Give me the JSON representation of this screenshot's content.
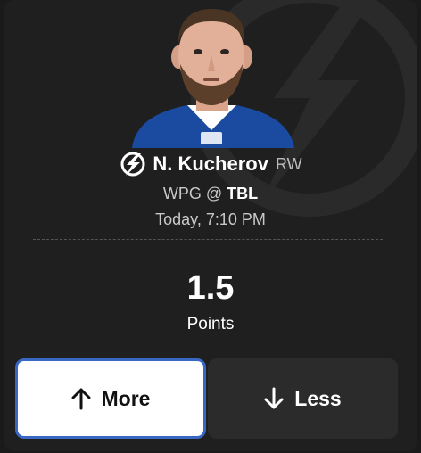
{
  "player": {
    "name": "N. Kucherov",
    "position": "RW"
  },
  "game": {
    "away_team": "WPG",
    "separator": "@",
    "home_team": "TBL",
    "time": "Today, 7:10 PM"
  },
  "projection": {
    "line": "1.5",
    "stat": "Points"
  },
  "actions": {
    "more_label": "More",
    "less_label": "Less"
  },
  "colors": {
    "card_bg": "#1f1f1f",
    "selected_border": "#3867c4",
    "jersey_blue": "#1a4ba0"
  }
}
